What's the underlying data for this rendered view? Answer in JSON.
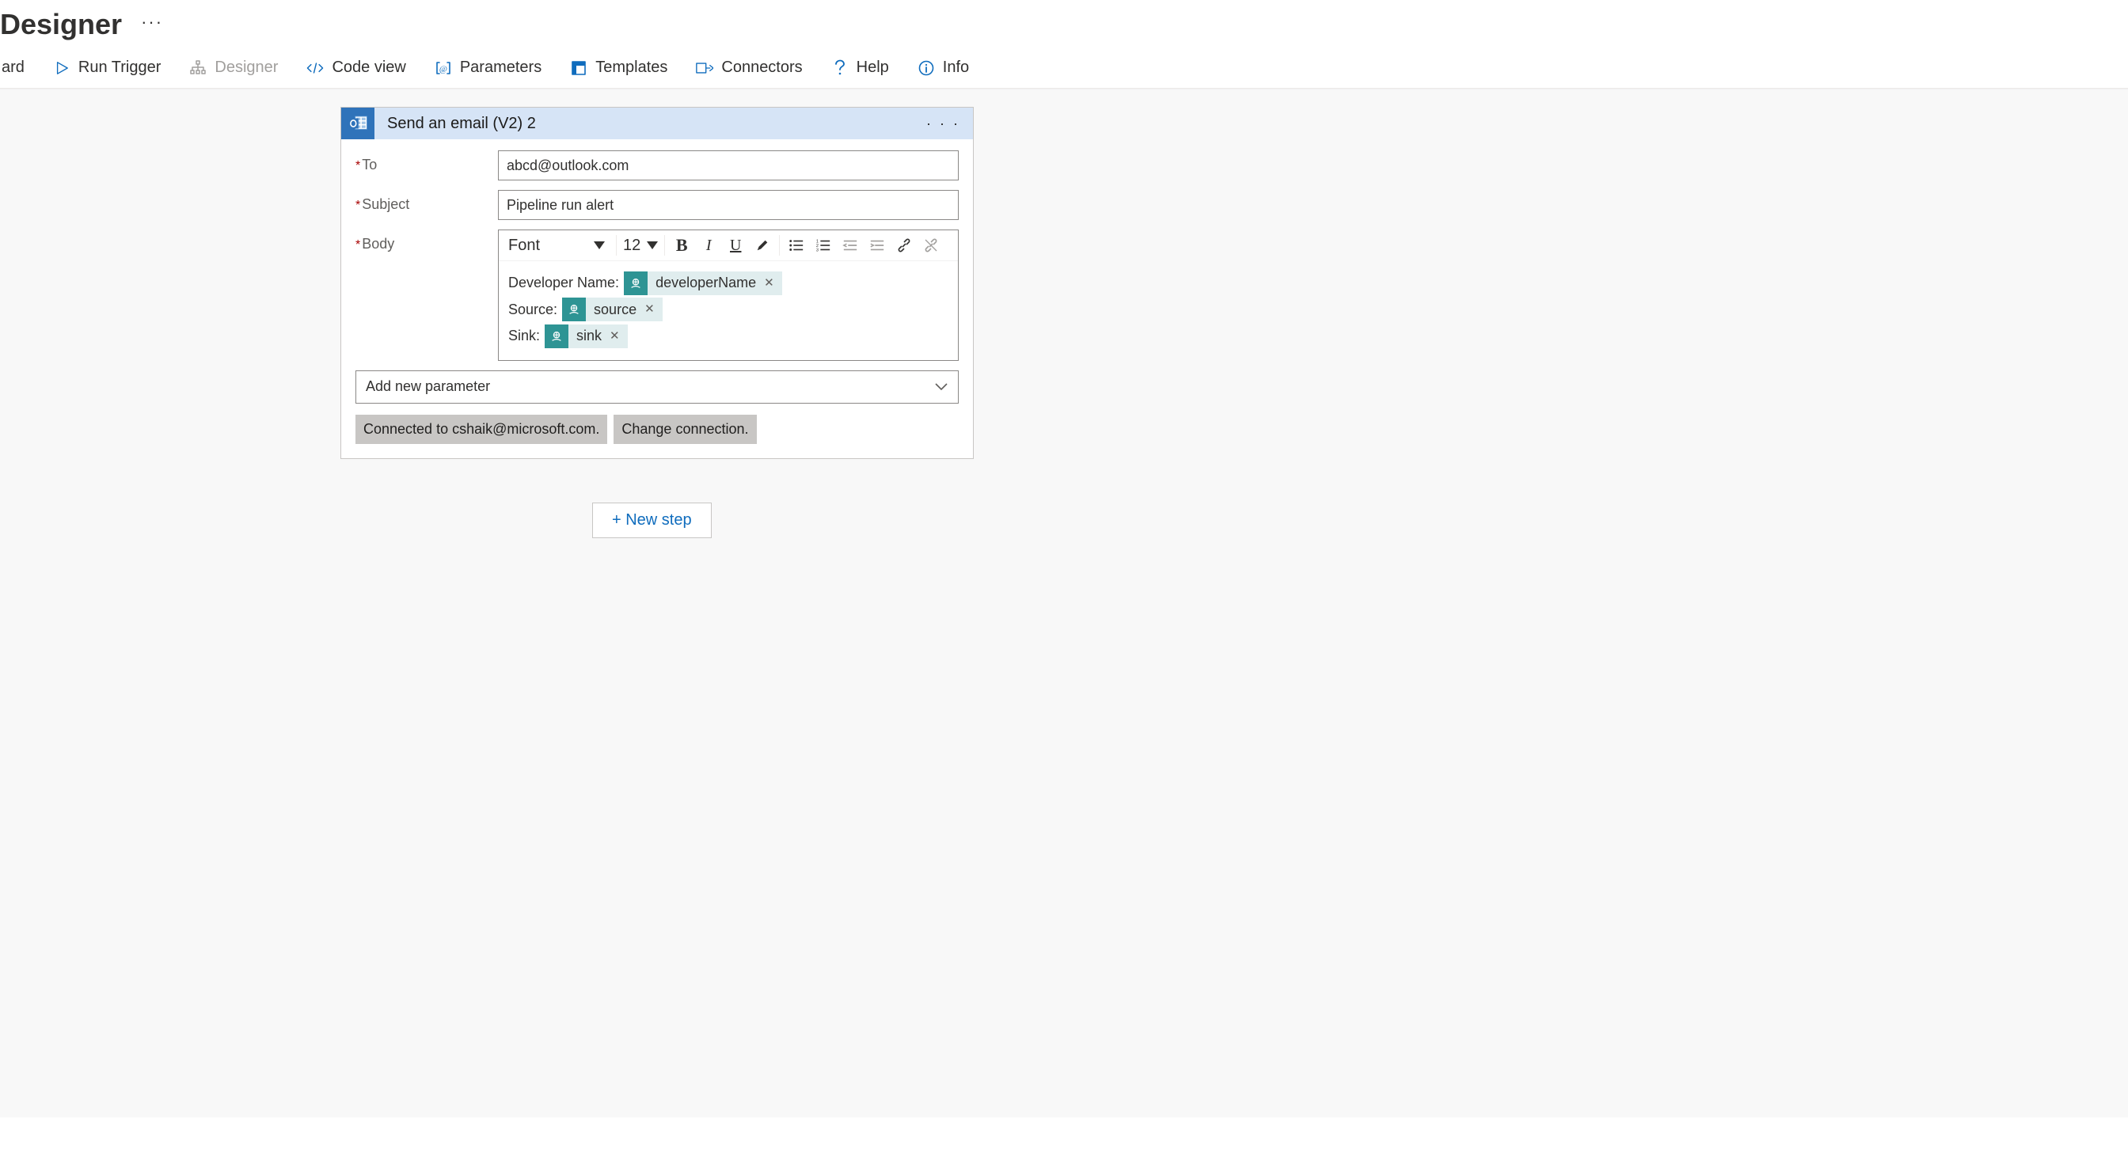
{
  "title": "Designer",
  "toolbar": {
    "prefix_cut": "ard",
    "items": {
      "run_trigger": "Run Trigger",
      "designer": "Designer",
      "code_view": "Code view",
      "parameters": "Parameters",
      "templates": "Templates",
      "connectors": "Connectors",
      "help": "Help",
      "info": "Info"
    }
  },
  "card": {
    "header": "Send an email (V2) 2",
    "labels": {
      "to": "To",
      "subject": "Subject",
      "body": "Body"
    },
    "values": {
      "to": "abcd@outlook.com",
      "subject": "Pipeline run alert"
    },
    "rte": {
      "font_label": "Font",
      "font_size": "12"
    },
    "body_lines": [
      {
        "prefix": "Developer Name:",
        "token": "developerName"
      },
      {
        "prefix": "Source:",
        "token": "source"
      },
      {
        "prefix": "Sink:",
        "token": "sink"
      }
    ],
    "add_param": "Add new parameter",
    "connected": "Connected to cshaik@microsoft.com.",
    "change_conn": "Change connection."
  },
  "new_step": "+ New step"
}
